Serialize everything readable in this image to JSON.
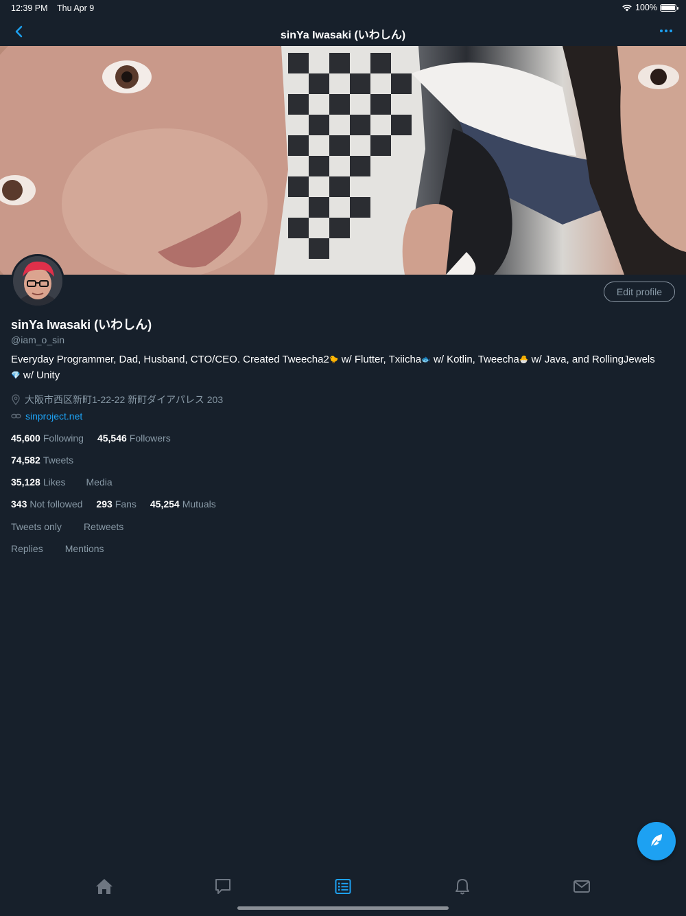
{
  "status_bar": {
    "time": "12:39 PM",
    "date": "Thu Apr 9",
    "battery": "100%"
  },
  "nav": {
    "title": "sinYa Iwasaki (いわしん)"
  },
  "profile": {
    "name": "sinYa Iwasaki (いわしん)",
    "handle": "@iam_o_sin",
    "edit_label": "Edit profile",
    "bio_parts": [
      "Everyday Programmer, Dad, Husband, CTO/CEO. Created Tweecha2",
      " w/ Flutter, Txiicha",
      " w/ Kotlin, Tweecha",
      " w/ Java, and RollingJewels",
      " w/ Unity"
    ],
    "bio_emoji": [
      "🐤",
      "🐟",
      "🐣",
      "💎"
    ],
    "location": "大阪市西区新町1-22-22 新町ダイアパレス 203",
    "url": "sinproject.net"
  },
  "stats": {
    "following": {
      "num": "45,600",
      "label": "Following"
    },
    "followers": {
      "num": "45,546",
      "label": "Followers"
    },
    "tweets": {
      "num": "74,582",
      "label": "Tweets"
    },
    "likes": {
      "num": "35,128",
      "label": "Likes"
    },
    "media": "Media",
    "not_followed": {
      "num": "343",
      "label": "Not followed"
    },
    "fans": {
      "num": "293",
      "label": "Fans"
    },
    "mutuals": {
      "num": "45,254",
      "label": "Mutuals"
    },
    "tweets_only": "Tweets only",
    "retweets": "Retweets",
    "replies": "Replies",
    "mentions": "Mentions"
  },
  "icons": {
    "back": "chevron-left-icon",
    "more": "more-icon",
    "compose": "feather-icon",
    "tabs": [
      "home-icon",
      "messages-icon",
      "lists-icon",
      "notifications-icon",
      "mail-icon"
    ]
  },
  "colors": {
    "background": "#17202b",
    "accent": "#1da1f2",
    "secondary_text": "#8899a6",
    "tab_inactive": "#6e7681"
  }
}
